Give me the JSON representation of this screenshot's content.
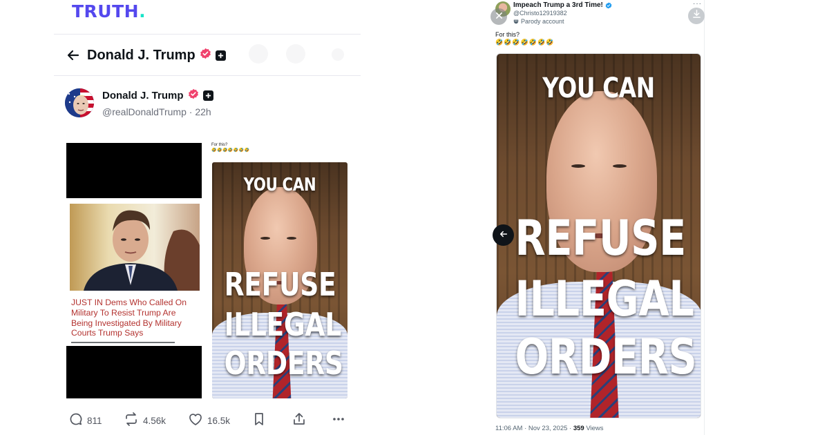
{
  "truth": {
    "logo_text": "TRUTH",
    "logo_dot": ".",
    "header_name": "Donald J. Trump",
    "author_name": "Donald J. Trump",
    "author_handle": "@realDonaldTrump",
    "time_sep": " · ",
    "post_age": "22h",
    "article_headline": "JUST IN Dems Who Called On Military To Resist Trump Are Being Investigated By Military Courts Trump Says",
    "small_caption": "For this?",
    "small_emoji": "🤣🤣🤣🤣🤣🤣🤣",
    "poster_line1": "YOU CAN",
    "poster_line2": "REFUSE",
    "poster_line3": "ILLEGAL",
    "poster_line4": "ORDERS",
    "actions": {
      "replies": "811",
      "retruths": "4.56k",
      "likes": "16.5k"
    },
    "colors": {
      "brand": "#5448ee",
      "brand_dot": "#17e3c8",
      "verified": "#f0426d"
    }
  },
  "x_post": {
    "display_name": "Impeach Trump a 3rd Time!",
    "handle": "@Christo12919382",
    "parody_label": "Parody account",
    "caption": "For this?",
    "emoji": "🤣🤣🤣🤣🤣🤣🤣",
    "poster_line1": "YOU CAN",
    "poster_line2": "REFUSE",
    "poster_line3": "ILLEGAL",
    "poster_line4": "ORDERS",
    "timestamp": "11:06 AM · Nov 23, 2025 · ",
    "views_count": "359",
    "views_label": " Views",
    "colors": {
      "verified": "#1d9bf0"
    }
  }
}
